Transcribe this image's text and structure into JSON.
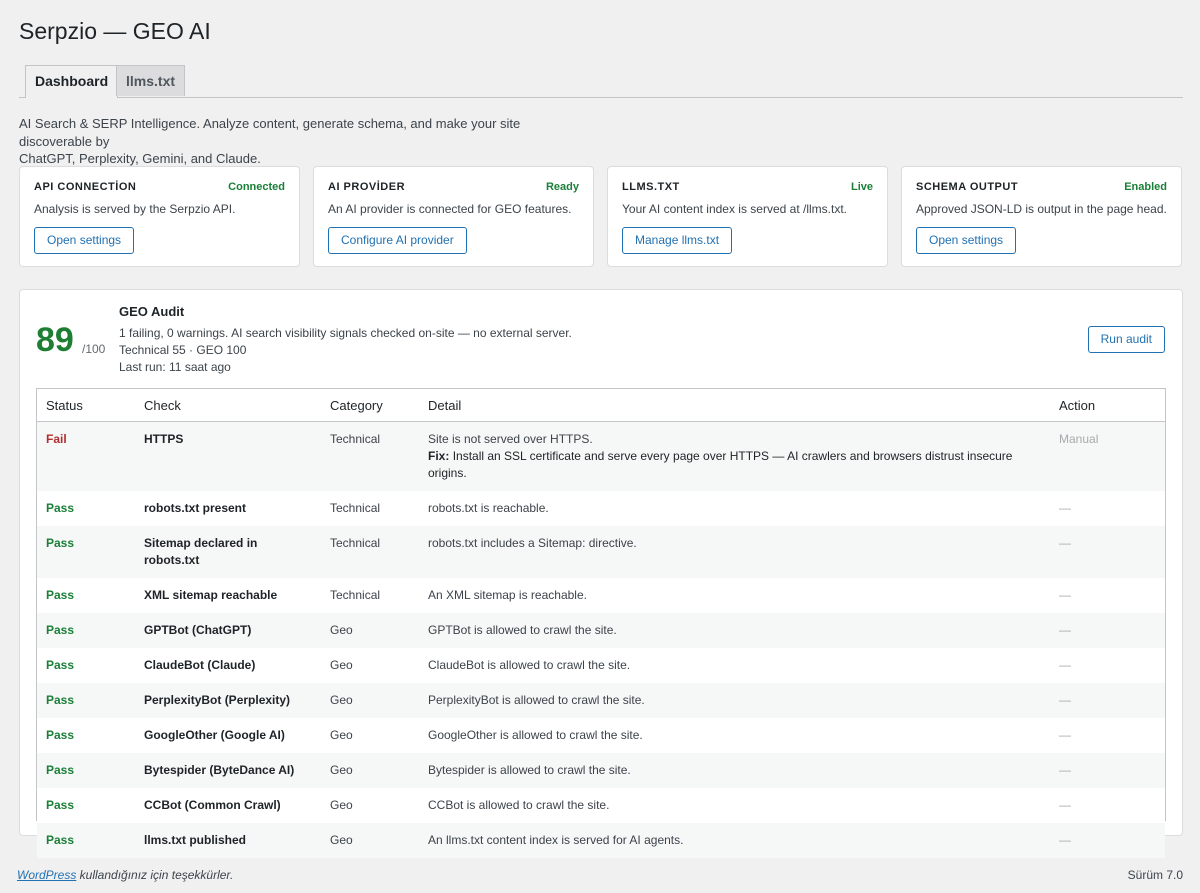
{
  "page": {
    "title": "Serpzio — GEO AI"
  },
  "tabs": [
    {
      "label": "Dashboard",
      "active": true
    },
    {
      "label": "llms.txt",
      "active": false
    }
  ],
  "intro": {
    "line1": "AI Search & SERP Intelligence. Analyze content, generate schema, and make your site discoverable by",
    "line2": "ChatGPT, Perplexity, Gemini, and Claude."
  },
  "cards": [
    {
      "title": "API CONNECTİON",
      "status": "Connected",
      "desc": "Analysis is served by the Serpzio API.",
      "button": "Open settings"
    },
    {
      "title": "AI PROVİDER",
      "status": "Ready",
      "desc": "An AI provider is connected for GEO features.",
      "button": "Configure AI provider"
    },
    {
      "title": "LLMS.TXT",
      "status": "Live",
      "desc": "Your AI content index is served at /llms.txt.",
      "button": "Manage llms.txt"
    },
    {
      "title": "SCHEMA OUTPUT",
      "status": "Enabled",
      "desc": "Approved JSON-LD is output in the page head.",
      "button": "Open settings"
    }
  ],
  "audit": {
    "score": "89",
    "score_max": "/100",
    "title": "GEO Audit",
    "summary": "1 failing, 0 warnings. AI search visibility signals checked on-site — no external server.",
    "breakdown": "Technical 55 · GEO 100",
    "last_run": "Last run: 11 saat ago",
    "run_button": "Run audit"
  },
  "table": {
    "headers": {
      "status": "Status",
      "check": "Check",
      "category": "Category",
      "detail": "Detail",
      "action": "Action"
    },
    "rows": [
      {
        "status": "Fail",
        "check": "HTTPS",
        "category": "Technical",
        "detail": "Site is not served over HTTPS.",
        "fix_label": "Fix:",
        "fix": "Install an SSL certificate and serve every page over HTTPS — AI crawlers and browsers distrust insecure",
        "fix2": "origins.",
        "action": "Manual"
      },
      {
        "status": "Pass",
        "check": "robots.txt present",
        "category": "Technical",
        "detail": "robots.txt is reachable.",
        "action": "—"
      },
      {
        "status": "Pass",
        "check": "Sitemap declared in",
        "check2": "robots.txt",
        "category": "Technical",
        "detail": "robots.txt includes a Sitemap: directive.",
        "action": "—"
      },
      {
        "status": "Pass",
        "check": "XML sitemap reachable",
        "category": "Technical",
        "detail": "An XML sitemap is reachable.",
        "action": "—"
      },
      {
        "status": "Pass",
        "check": "GPTBot (ChatGPT)",
        "category": "Geo",
        "detail": "GPTBot is allowed to crawl the site.",
        "action": "—"
      },
      {
        "status": "Pass",
        "check": "ClaudeBot (Claude)",
        "category": "Geo",
        "detail": "ClaudeBot is allowed to crawl the site.",
        "action": "—"
      },
      {
        "status": "Pass",
        "check": "PerplexityBot (Perplexity)",
        "category": "Geo",
        "detail": "PerplexityBot is allowed to crawl the site.",
        "action": "—"
      },
      {
        "status": "Pass",
        "check": "GoogleOther (Google AI)",
        "category": "Geo",
        "detail": "GoogleOther is allowed to crawl the site.",
        "action": "—"
      },
      {
        "status": "Pass",
        "check": "Bytespider (ByteDance AI)",
        "category": "Geo",
        "detail": "Bytespider is allowed to crawl the site.",
        "action": "—"
      },
      {
        "status": "Pass",
        "check": "CCBot (Common Crawl)",
        "category": "Geo",
        "detail": "CCBot is allowed to crawl the site.",
        "action": "—"
      },
      {
        "status": "Pass",
        "check": "llms.txt published",
        "category": "Geo",
        "detail": "An llms.txt content index is served for AI agents.",
        "action": "—"
      }
    ]
  },
  "footer": {
    "link": "WordPress",
    "text": " kullandığınız için teşekkürler.",
    "version": "Sürüm 7.0"
  }
}
